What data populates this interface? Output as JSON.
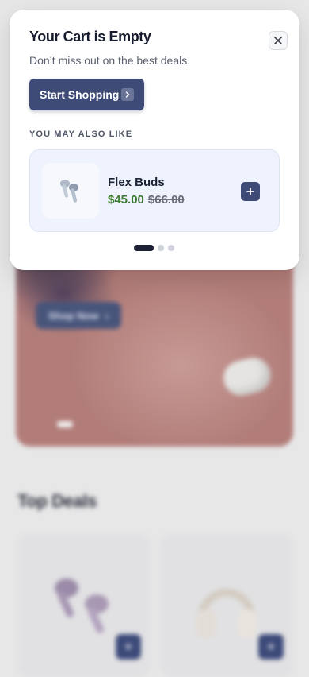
{
  "popup": {
    "title": "Your Cart is Empty",
    "subtitle": "Don’t miss out on the best deals.",
    "cta_label": "Start Shopping",
    "section_label": "YOU MAY ALSO LIKE",
    "recommendation": {
      "name": "Flex Buds",
      "price": "$45.00",
      "original_price": "$66.00",
      "icon": "earbuds-icon"
    },
    "carousel": {
      "count": 3,
      "active_index": 0
    }
  },
  "background": {
    "hero_cta_label": "Shop Now",
    "deals_title": "Top Deals"
  },
  "colors": {
    "primary": "#3f4b77",
    "price_green": "#3b7a2f",
    "card_bg": "#eef3fd"
  }
}
